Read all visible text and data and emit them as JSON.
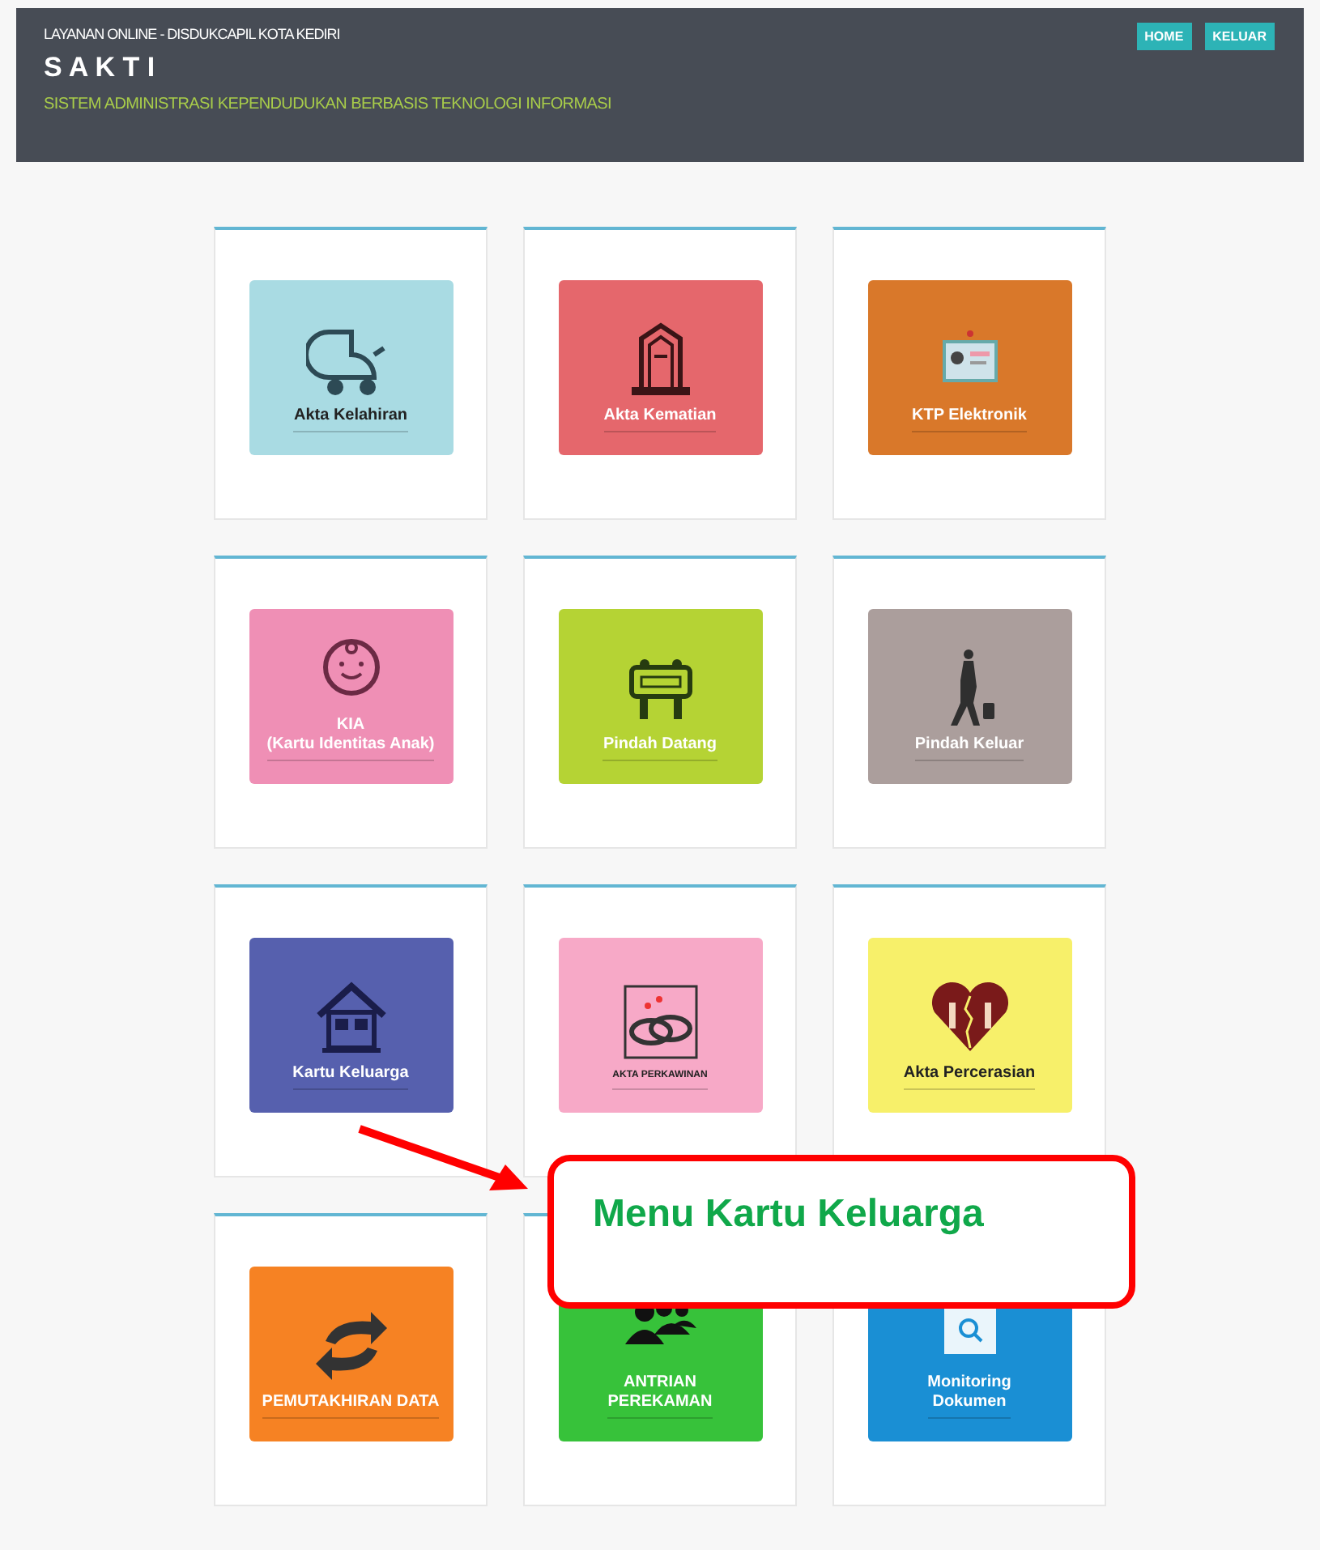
{
  "header": {
    "subtitle": "LAYANAN ONLINE - DISDUKCAPIL KOTA KEDIRI",
    "title": "S A K T I",
    "tagline": "SISTEM ADMINISTRASI KEPENDUDUKAN BERBASIS TEKNOLOGI INFORMASI",
    "buttons": [
      "HOME",
      "KELUAR"
    ]
  },
  "tiles": [
    {
      "label": "Akta Kelahiran",
      "kind": "stroller",
      "color": "#a9dbe3"
    },
    {
      "label": "Akta Kematian",
      "kind": "gravestone",
      "color": "#e5676c"
    },
    {
      "label": "KTP Elektronik",
      "kind": "idcard",
      "color": "#d9782a"
    },
    {
      "label": "KIA\n(Kartu Identitas Anak)",
      "kind": "baby",
      "color": "#ef8fb5"
    },
    {
      "label": "Pindah Datang",
      "kind": "sign",
      "color": "#b5d334"
    },
    {
      "label": "Pindah Keluar",
      "kind": "traveler",
      "color": "#ab9e9c"
    },
    {
      "label": "Kartu Keluarga",
      "kind": "house",
      "color": "#5660ae"
    },
    {
      "label": "AKTA PERKAWINAN",
      "kind": "rings",
      "color": "#f7a9c7"
    },
    {
      "label": "Akta Percerasian",
      "kind": "heart",
      "color": "#f7f06a"
    },
    {
      "label": "PEMUTAKHIRAN DATA",
      "kind": "arrows",
      "color": "#f68223"
    },
    {
      "label": "ANTRIAN\nPEREKAMAN",
      "kind": "people",
      "color": "#37c23a"
    },
    {
      "label": "Monitoring\nDokumen",
      "kind": "folder",
      "color": "#1a8fd4"
    }
  ],
  "callout": {
    "text": "Menu Kartu Keluarga"
  }
}
